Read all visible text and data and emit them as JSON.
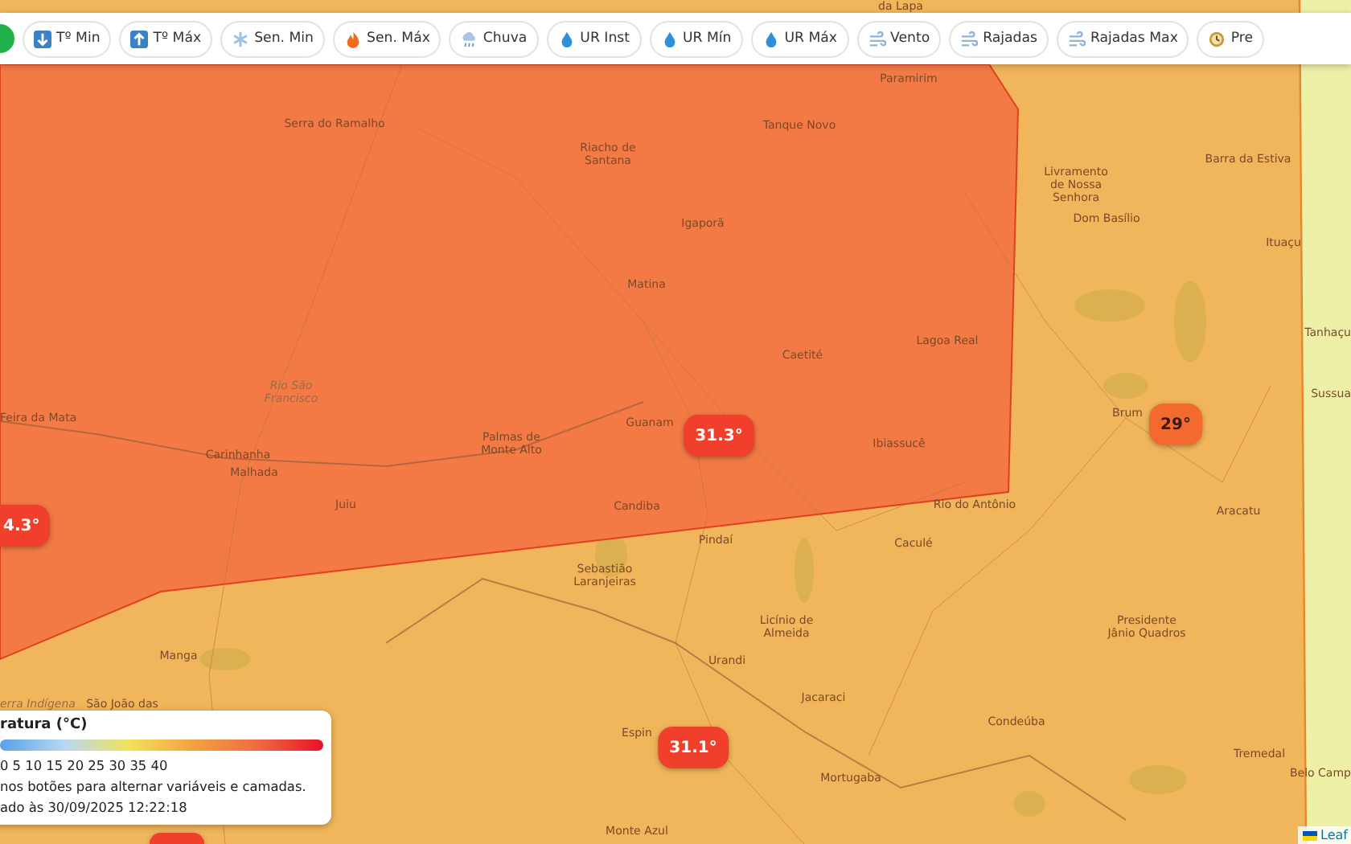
{
  "toolbar": {
    "buttons": [
      {
        "label": "Tº Min",
        "kind": "arrow-down"
      },
      {
        "label": "Tº Máx",
        "kind": "arrow-up"
      },
      {
        "label": "Sen. Min",
        "kind": "snow"
      },
      {
        "label": "Sen. Máx",
        "kind": "fire"
      },
      {
        "label": "Chuva",
        "kind": "rain"
      },
      {
        "label": "UR Inst",
        "kind": "drop"
      },
      {
        "label": "UR Mín",
        "kind": "drop"
      },
      {
        "label": "UR Máx",
        "kind": "drop"
      },
      {
        "label": "Vento",
        "kind": "wind"
      },
      {
        "label": "Rajadas",
        "kind": "wind"
      },
      {
        "label": "Rajadas Max",
        "kind": "wind"
      },
      {
        "label": "Pre",
        "kind": "clock"
      }
    ]
  },
  "map": {
    "places": [
      {
        "name": "da Lapa",
        "kind": "town"
      },
      {
        "name": "Paramirim",
        "kind": "town"
      },
      {
        "name": "Serra do Ramalho",
        "kind": "town"
      },
      {
        "name": "Tanque Novo",
        "kind": "town"
      },
      {
        "name": "Riacho de\nSantana",
        "kind": "town"
      },
      {
        "name": "Barra da Estiva",
        "kind": "town"
      },
      {
        "name": "Livramento\nde Nossa\nSenhora",
        "kind": "town"
      },
      {
        "name": "Dom Basílio",
        "kind": "town"
      },
      {
        "name": "Igaporã",
        "kind": "town"
      },
      {
        "name": "Ituaçu",
        "kind": "town"
      },
      {
        "name": "Matina",
        "kind": "town"
      },
      {
        "name": "Tanhaçu",
        "kind": "town"
      },
      {
        "name": "Lagoa Real",
        "kind": "town"
      },
      {
        "name": "Caetité",
        "kind": "town"
      },
      {
        "name": "Rio São\nFrancisco",
        "kind": "river"
      },
      {
        "name": "Sussua",
        "kind": "town"
      },
      {
        "name": "Brum",
        "kind": "town"
      },
      {
        "name": "Feira da Mata",
        "kind": "town"
      },
      {
        "name": "Guanam",
        "kind": "town"
      },
      {
        "name": "Palmas de\nMonte Alto",
        "kind": "town"
      },
      {
        "name": "Ibiassucê",
        "kind": "town"
      },
      {
        "name": "Carinhanha",
        "kind": "town"
      },
      {
        "name": "Malhada",
        "kind": "town"
      },
      {
        "name": "Juiu",
        "kind": "town"
      },
      {
        "name": "Candiba",
        "kind": "town"
      },
      {
        "name": "Rio do Antônio",
        "kind": "town"
      },
      {
        "name": "Aracatu",
        "kind": "town"
      },
      {
        "name": "Pindaí",
        "kind": "town"
      },
      {
        "name": "Caculé",
        "kind": "town"
      },
      {
        "name": "Sebastião\nLaranjeiras",
        "kind": "town"
      },
      {
        "name": "Licínio de\nAlmeida",
        "kind": "town"
      },
      {
        "name": "Presidente\nJânio Quadros",
        "kind": "town"
      },
      {
        "name": "Manga",
        "kind": "town"
      },
      {
        "name": "Urandi",
        "kind": "town"
      },
      {
        "name": "Jacaraci",
        "kind": "town"
      },
      {
        "name": "erra Indígena",
        "kind": "area"
      },
      {
        "name": "São João das",
        "kind": "town"
      },
      {
        "name": "Condeúba",
        "kind": "town"
      },
      {
        "name": "Espin",
        "kind": "town"
      },
      {
        "name": "Tremedal",
        "kind": "town"
      },
      {
        "name": "Belo Camp",
        "kind": "town"
      },
      {
        "name": "Mortugaba",
        "kind": "town"
      },
      {
        "name": "Monte Azul",
        "kind": "town"
      }
    ],
    "markers": [
      {
        "value": "31.3°",
        "color": "#f0402c"
      },
      {
        "value": "29°",
        "color": "#f36a30"
      },
      {
        "value": "4.3°",
        "color": "#f0402c"
      },
      {
        "value": "31.1°",
        "color": "#f0402c"
      },
      {
        "color": "#f0402c"
      }
    ],
    "attribution": "Leaf"
  },
  "legend": {
    "title": "ratura (°C)",
    "scale": "0 5 10 15 20 25 30 35 40",
    "hint": "nos botões para alternar variáveis e camadas.",
    "updated": "ado às 30/09/2025 12:22:18"
  }
}
